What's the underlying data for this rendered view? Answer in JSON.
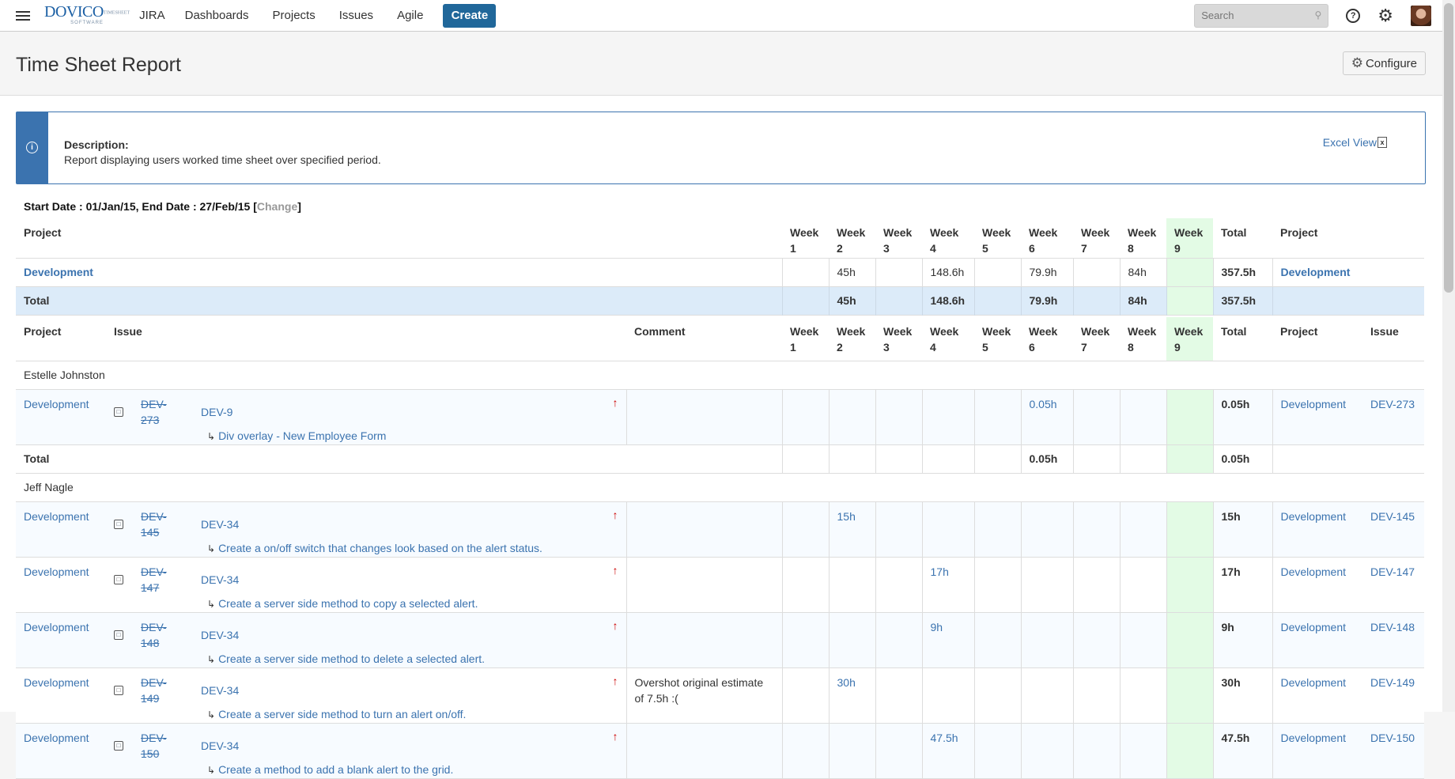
{
  "nav": {
    "brand": "DOVICO",
    "brand_tag": "TIMESHEET",
    "brand_sub": "SOFTWARE",
    "jira": "JIRA",
    "items": [
      "Dashboards",
      "Projects",
      "Issues",
      "Agile"
    ],
    "create_label": "Create",
    "search_placeholder": "Search",
    "help_glyph": "?"
  },
  "header": {
    "title": "Time Sheet Report",
    "configure_label": "Configure"
  },
  "description": {
    "title": "Description:",
    "text": "Report displaying users worked time sheet over specified period.",
    "excel_label": "Excel View",
    "excel_glyph": "x"
  },
  "dates": {
    "prefix": "Start Date : 01/Jan/15, End Date : 27/Feb/15 [",
    "change": "Change",
    "suffix": "]"
  },
  "weeks": [
    "Week 1",
    "Week 2",
    "Week 3",
    "Week 4",
    "Week 5",
    "Week 6",
    "Week 7",
    "Week 8",
    "Week 9"
  ],
  "summary": {
    "headers": {
      "project": "Project",
      "total": "Total",
      "project_end": "Project"
    },
    "row": {
      "project": "Development",
      "values": [
        "",
        "45h",
        "",
        "148.6h",
        "",
        "79.9h",
        "",
        "84h",
        ""
      ],
      "total": "357.5h",
      "project_end": "Development"
    },
    "total_row": {
      "label": "Total",
      "values": [
        "",
        "45h",
        "",
        "148.6h",
        "",
        "79.9h",
        "",
        "84h",
        ""
      ],
      "total": "357.5h"
    }
  },
  "detail": {
    "headers": {
      "project": "Project",
      "issue": "Issue",
      "comment": "Comment",
      "total": "Total",
      "project_end": "Project",
      "issue_end": "Issue"
    },
    "users": [
      {
        "name": "Estelle Johnston",
        "rows": [
          {
            "project": "Development",
            "key": "DEV-273",
            "parent": "DEV-9",
            "summary": "Div overlay - New Employee Form",
            "comment": "",
            "values": [
              "",
              "",
              "",
              "",
              "",
              "0.05h",
              "",
              "",
              ""
            ],
            "total": "0.05h",
            "project_end": "Development",
            "issue_end": "DEV-273"
          }
        ],
        "total_label": "Total",
        "total_values": [
          "",
          "",
          "",
          "",
          "",
          "0.05h",
          "",
          "",
          ""
        ],
        "total": "0.05h"
      },
      {
        "name": "Jeff Nagle",
        "rows": [
          {
            "project": "Development",
            "key": "DEV-145",
            "parent": "DEV-34",
            "summary": "Create a on/off switch that changes look based on the alert status.",
            "comment": "",
            "values": [
              "",
              "15h",
              "",
              "",
              "",
              "",
              "",
              "",
              ""
            ],
            "total": "15h",
            "project_end": "Development",
            "issue_end": "DEV-145"
          },
          {
            "project": "Development",
            "key": "DEV-147",
            "parent": "DEV-34",
            "summary": "Create a server side method to copy a selected alert.",
            "comment": "",
            "values": [
              "",
              "",
              "",
              "17h",
              "",
              "",
              "",
              "",
              ""
            ],
            "total": "17h",
            "project_end": "Development",
            "issue_end": "DEV-147"
          },
          {
            "project": "Development",
            "key": "DEV-148",
            "parent": "DEV-34",
            "summary": "Create a server side method to delete a selected alert.",
            "comment": "",
            "values": [
              "",
              "",
              "",
              "9h",
              "",
              "",
              "",
              "",
              ""
            ],
            "total": "9h",
            "project_end": "Development",
            "issue_end": "DEV-148"
          },
          {
            "project": "Development",
            "key": "DEV-149",
            "parent": "DEV-34",
            "summary": "Create a server side method to turn an alert on/off.",
            "comment": "Overshot original estimate of 7.5h :(",
            "values": [
              "",
              "30h",
              "",
              "",
              "",
              "",
              "",
              "",
              ""
            ],
            "total": "30h",
            "project_end": "Development",
            "issue_end": "DEV-149"
          },
          {
            "project": "Development",
            "key": "DEV-150",
            "parent": "DEV-34",
            "summary": "Create a method to add a blank alert to the grid.",
            "comment": "",
            "values": [
              "",
              "",
              "",
              "47.5h",
              "",
              "",
              "",
              "",
              ""
            ],
            "total": "47.5h",
            "project_end": "Development",
            "issue_end": "DEV-150"
          }
        ]
      }
    ]
  },
  "icons": {
    "menu": "hamburger-icon",
    "search": "search-icon",
    "help": "help-icon",
    "settings": "gear-icon",
    "info": "info-icon",
    "excel": "excel-icon",
    "story": "story-icon",
    "priority": "arrow-up-icon",
    "subtask": "subtask-arrow-icon"
  },
  "colors": {
    "link": "#3b73af",
    "create": "#20679a",
    "week9_highlight": "#e3fbe5",
    "total_row": "#dcebf9",
    "priority": "#cc0000"
  }
}
